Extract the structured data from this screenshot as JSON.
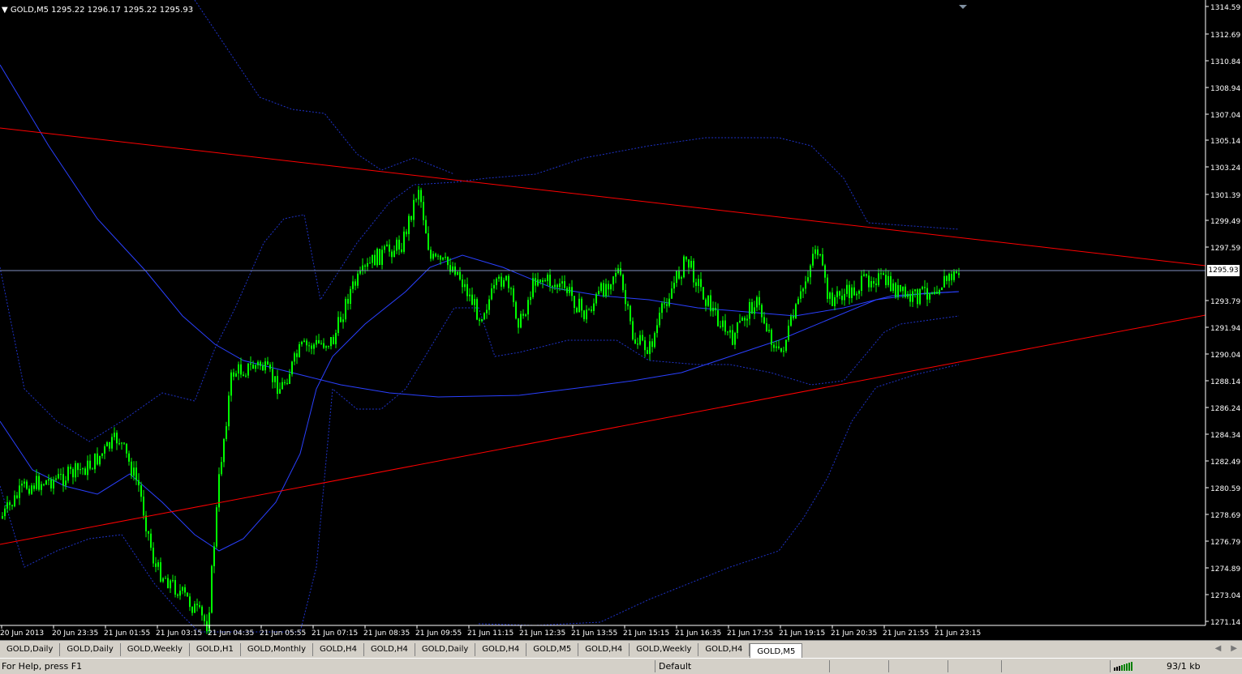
{
  "chart": {
    "symbol_info": "GOLD,M5  1295.22 1296.17 1295.22 1295.93",
    "current_price": "1295.93",
    "price_axis": [
      "1314.59",
      "1312.69",
      "1310.84",
      "1308.94",
      "1307.04",
      "1305.14",
      "1303.24",
      "1301.39",
      "1299.49",
      "1297.59",
      "1293.79",
      "1291.94",
      "1290.04",
      "1288.14",
      "1286.24",
      "1284.34",
      "1282.49",
      "1280.59",
      "1278.69",
      "1276.79",
      "1274.89",
      "1273.04",
      "1271.14"
    ],
    "time_axis": [
      "20 Jun 2013",
      "20 Jun 23:35",
      "21 Jun 01:55",
      "21 Jun 03:15",
      "21 Jun 04:35",
      "21 Jun 05:55",
      "21 Jun 07:15",
      "21 Jun 08:35",
      "21 Jun 09:55",
      "21 Jun 11:15",
      "21 Jun 12:35",
      "21 Jun 13:55",
      "21 Jun 15:15",
      "21 Jun 16:35",
      "21 Jun 17:55",
      "21 Jun 19:15",
      "21 Jun 20:35",
      "21 Jun 21:55",
      "21 Jun 23:15"
    ],
    "colors": {
      "background": "#000000",
      "candles": "#00ff00",
      "trendlines": "#ff0000",
      "bollinger_bands": "#1e32c8",
      "moving_average": "#2a40ff",
      "axis_text": "#ffffff",
      "bid_line": "#8090c0"
    }
  },
  "tabs": [
    {
      "label": "GOLD,Daily"
    },
    {
      "label": "GOLD,Daily"
    },
    {
      "label": "GOLD,Weekly"
    },
    {
      "label": "GOLD,H1"
    },
    {
      "label": "GOLD,Monthly"
    },
    {
      "label": "GOLD,H4"
    },
    {
      "label": "GOLD,H4"
    },
    {
      "label": "GOLD,Daily"
    },
    {
      "label": "GOLD,H4"
    },
    {
      "label": "GOLD,M5"
    },
    {
      "label": "GOLD,H4"
    },
    {
      "label": "GOLD,Weekly"
    },
    {
      "label": "GOLD,H4"
    },
    {
      "label": "GOLD,M5",
      "active": true
    }
  ],
  "status": {
    "help": "For Help, press F1",
    "profile": "Default",
    "traffic": "93/1 kb"
  }
}
